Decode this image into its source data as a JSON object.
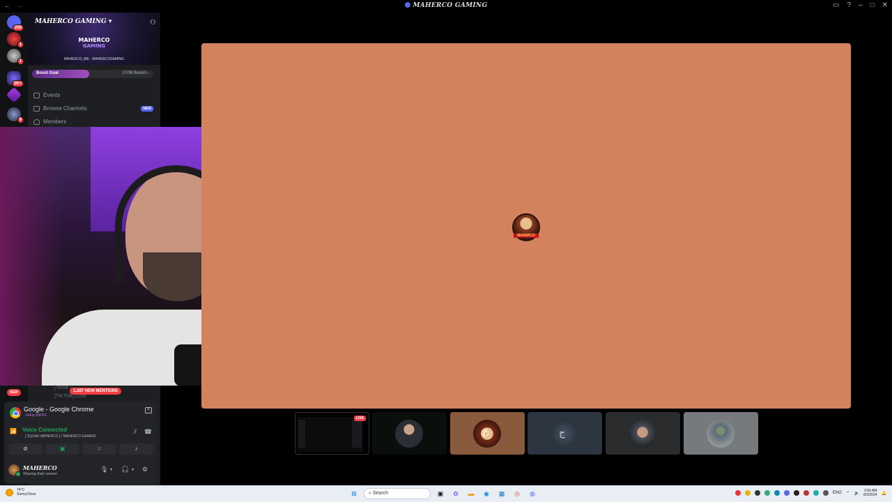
{
  "window": {
    "title": "MAHERCO GAMING",
    "nav_back": "←",
    "nav_forward": "→"
  },
  "rail": {
    "badges": [
      "256",
      "1",
      "1",
      "1K+",
      "9"
    ]
  },
  "server": {
    "name": "MAHERCO GAMING",
    "logo_top": "MAHERCO",
    "logo_bottom": "GAMING",
    "handles": "MAHERCO_ME · MAHERCOGAMING",
    "boost_label": "Boost Goal",
    "boost_count": "17/36 Boosts",
    "boost_progress": 0.47,
    "nav": [
      {
        "label": "Events"
      },
      {
        "label": "Browse Channels",
        "tag": "NEW"
      },
      {
        "label": "Members"
      }
    ]
  },
  "hidden_channels": [
    "[ RISE ] ...",
    "[TIKTOK] LIVE"
  ],
  "new_pill": "NEW",
  "mentions": "1,287 NEW MENTIONS",
  "stream": {
    "title": "Google - Google Chrome",
    "quality": "1440p 60FPS"
  },
  "voice": {
    "status": "Voice Connected",
    "channel": "[ SQUAD MAHERCO ] / MAHERCO GAMING"
  },
  "user": {
    "name": "MAHERCO",
    "status": "Sharing their screen"
  },
  "stage": {
    "participant_label": "MAHERCO"
  },
  "tiles": [
    {
      "kind": "screen",
      "live": "LIVE"
    },
    {
      "kind": "avatar",
      "bg": "#0b0f0c"
    },
    {
      "kind": "avatar",
      "bg": "#8a5a3c"
    },
    {
      "kind": "avatar",
      "bg": "#2c3540"
    },
    {
      "kind": "avatar",
      "bg": "#2a2c2e"
    },
    {
      "kind": "avatar",
      "bg": "#777a7d"
    }
  ],
  "taskbar": {
    "weather_temp": "74°C",
    "weather_desc": "Sunny/Clear",
    "search": "Search",
    "lang": "ENG",
    "time": "3:56 AM",
    "date": "8/3/2024"
  },
  "colors": {
    "stage": "#d3825e",
    "accent": "#5865f2",
    "green": "#23a55a",
    "red": "#f23f43"
  }
}
